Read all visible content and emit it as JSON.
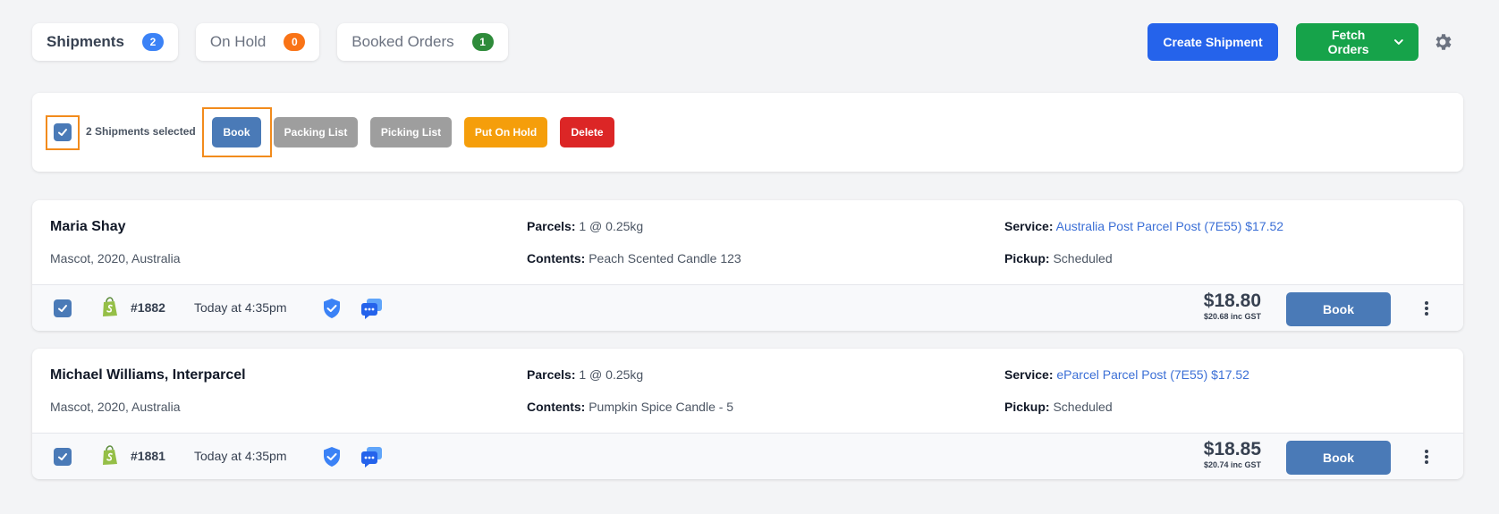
{
  "tabs": [
    {
      "label": "Shipments",
      "count": "2",
      "color": "#3b82f6",
      "active": true
    },
    {
      "label": "On Hold",
      "count": "0",
      "color": "#f97316"
    },
    {
      "label": "Booked Orders",
      "count": "1",
      "color": "#2e8b3a"
    }
  ],
  "actions": {
    "create_label": "Create Shipment",
    "fetch_label": "Fetch Orders",
    "settings_icon": "gear-icon"
  },
  "bulk": {
    "selected_text": "2 Shipments selected",
    "buttons": {
      "book": "Book",
      "packing": "Packing List",
      "picking": "Picking List",
      "hold": "Put On Hold",
      "delete": "Delete"
    }
  },
  "labels": {
    "parcels": "Parcels:",
    "contents": "Contents:",
    "service": "Service:",
    "pickup": "Pickup:"
  },
  "shipments": [
    {
      "name": "Maria Shay",
      "address": "Mascot, 2020, Australia",
      "parcels": "1 @ 0.25kg",
      "contents": "Peach Scented Candle 123",
      "service": "Australia Post Parcel Post (7E55) $17.52",
      "pickup": "Scheduled",
      "order_no": "#1882",
      "time": "Today at 4:35pm",
      "price": "$18.80",
      "gst": "$20.68 inc GST",
      "book_label": "Book",
      "checked": true
    },
    {
      "name": "Michael Williams, Interparcel",
      "address": "Mascot, 2020, Australia",
      "parcels": "1 @ 0.25kg",
      "contents": "Pumpkin Spice Candle - 5",
      "service": "eParcel Parcel Post (7E55) $17.52",
      "pickup": "Scheduled",
      "order_no": "#1881",
      "time": "Today at 4:35pm",
      "price": "$18.85",
      "gst": "$20.74 inc GST",
      "book_label": "Book",
      "checked": true
    }
  ],
  "colors": {
    "primary_blue": "#2563eb",
    "green": "#16a34a",
    "book_blue": "#4a7ab7",
    "highlight": "#f28b1c"
  }
}
